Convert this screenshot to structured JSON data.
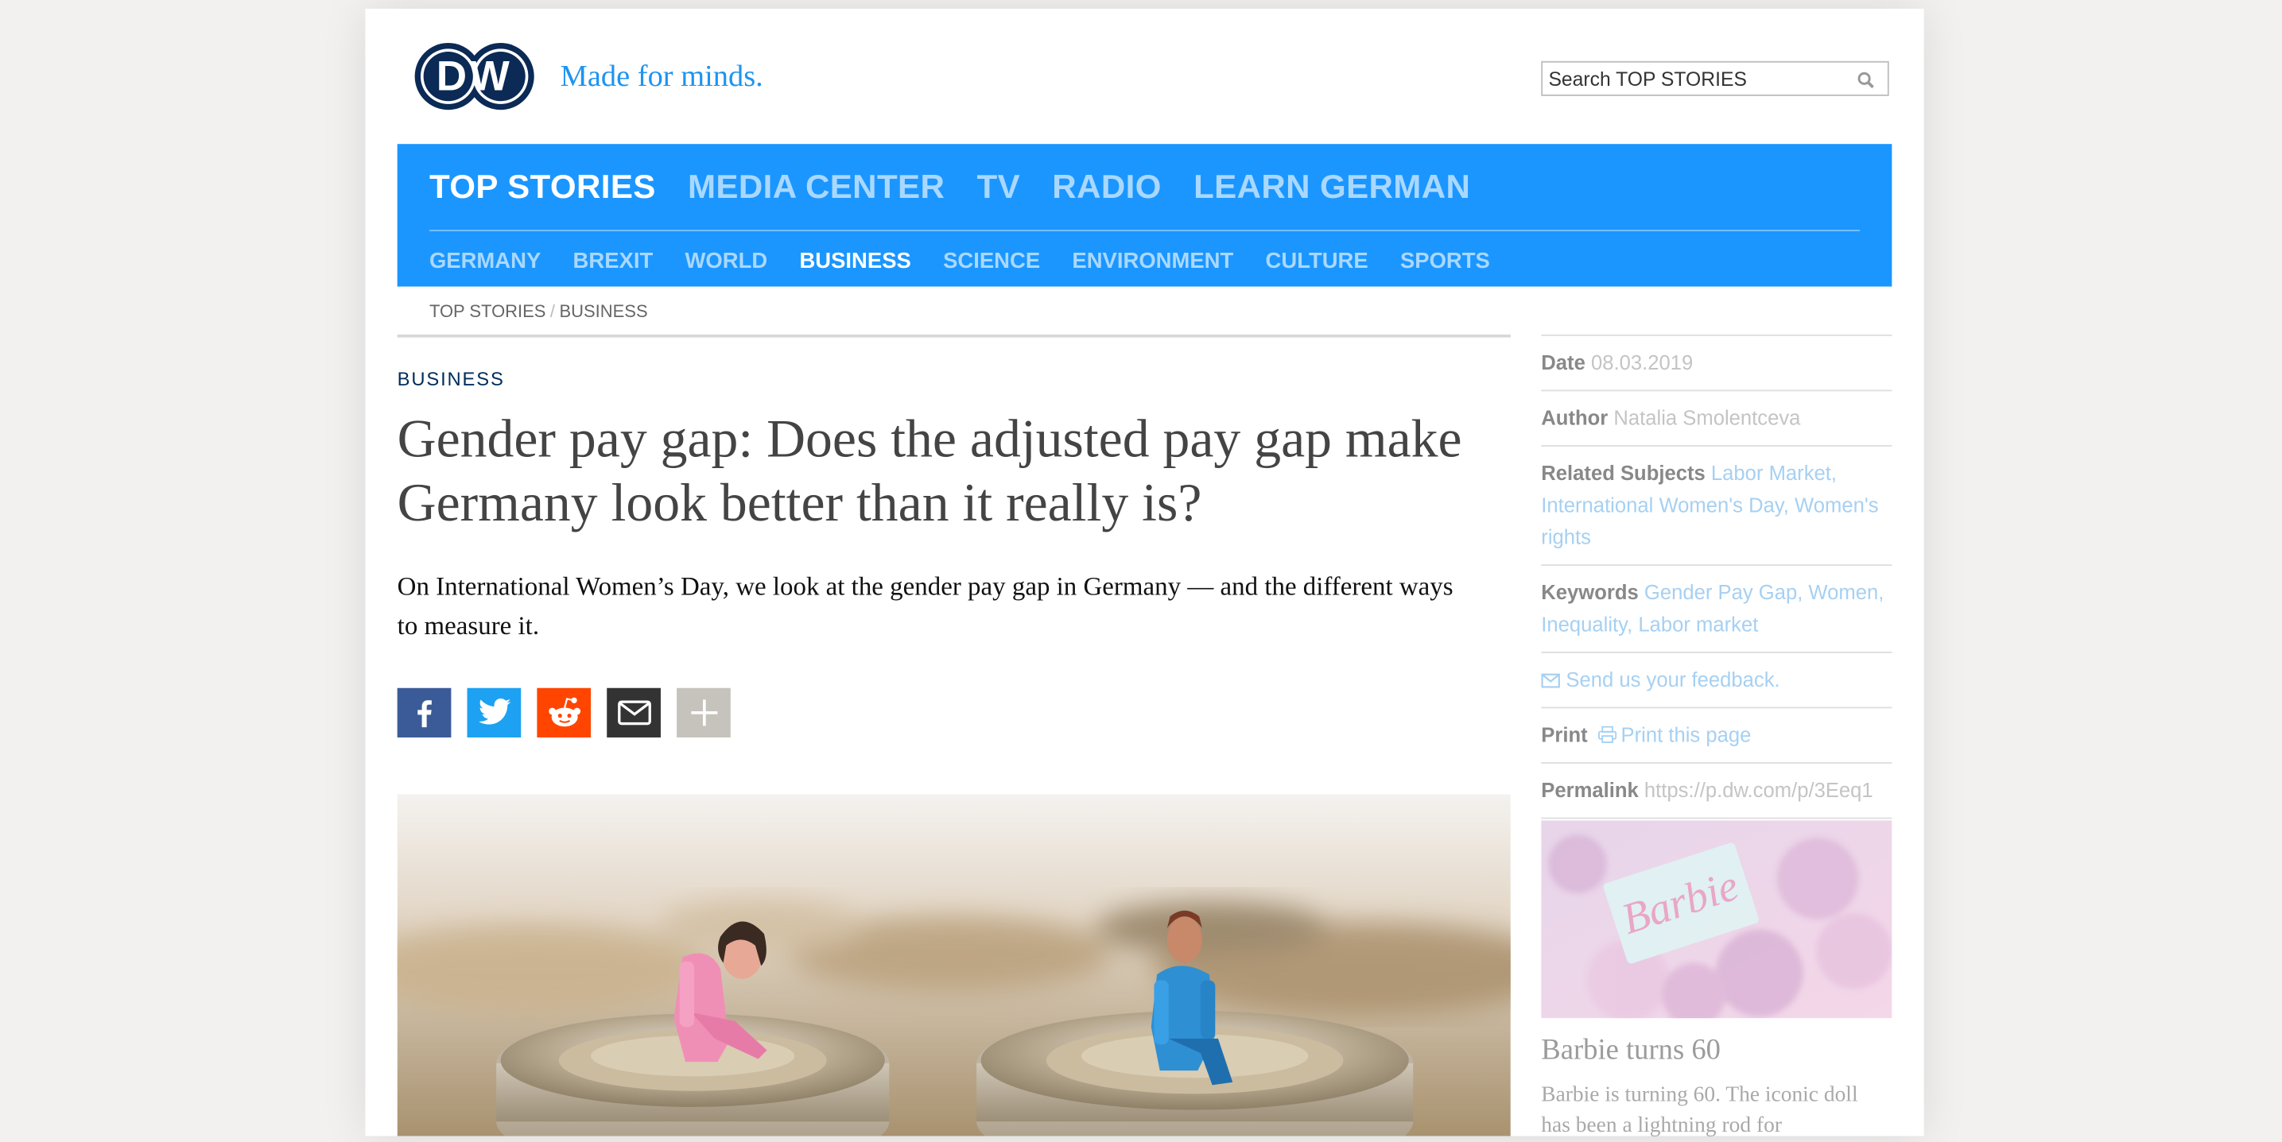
{
  "brand": {
    "logo_text": "DW",
    "tagline": "Made for minds."
  },
  "search": {
    "placeholder": "Search TOP STORIES"
  },
  "nav": {
    "main": [
      "TOP STORIES",
      "MEDIA CENTER",
      "TV",
      "RADIO",
      "LEARN GERMAN"
    ],
    "main_active": "TOP STORIES",
    "sub": [
      "GERMANY",
      "BREXIT",
      "WORLD",
      "BUSINESS",
      "SCIENCE",
      "ENVIRONMENT",
      "CULTURE",
      "SPORTS"
    ],
    "sub_active": "BUSINESS",
    "brand_color": "#1b96ff"
  },
  "breadcrumb": {
    "items": [
      "TOP STORIES",
      "BUSINESS"
    ],
    "separator": "/"
  },
  "article": {
    "kicker": "BUSINESS",
    "headline": "Gender pay gap: Does the adjusted pay gap make Germany look better than it really is?",
    "teaser": "On International Women’s Day, we look at the gender pay gap in Germany — and the different ways to measure it."
  },
  "share": [
    {
      "icon": "facebook-icon",
      "color": "#3b5b98"
    },
    {
      "icon": "twitter-icon",
      "color": "#1da1f2"
    },
    {
      "icon": "reddit-icon",
      "color": "#ff4500"
    },
    {
      "icon": "email-icon",
      "color": "#333333"
    },
    {
      "icon": "plus-icon",
      "color": "#c6c3bd"
    }
  ],
  "meta": {
    "date_label": "Date",
    "date": "08.03.2019",
    "author_label": "Author",
    "author": "Natalia Smolentceva",
    "related_label": "Related Subjects",
    "related": [
      "Labor Market",
      "International Women's Day",
      "Women's rights"
    ],
    "keywords_label": "Keywords",
    "keywords": [
      "Gender Pay Gap",
      "Women",
      "Inequality",
      "Labor market"
    ],
    "feedback": "Send us your feedback.",
    "print_label": "Print",
    "print_link": "Print this page",
    "permalink_label": "Permalink",
    "permalink": "https://p.dw.com/p/3Eeq1"
  },
  "promo": {
    "image_text": "Barbie",
    "title": "Barbie turns 60",
    "text": "Barbie is turning 60. The iconic doll has been a lightning rod for"
  }
}
